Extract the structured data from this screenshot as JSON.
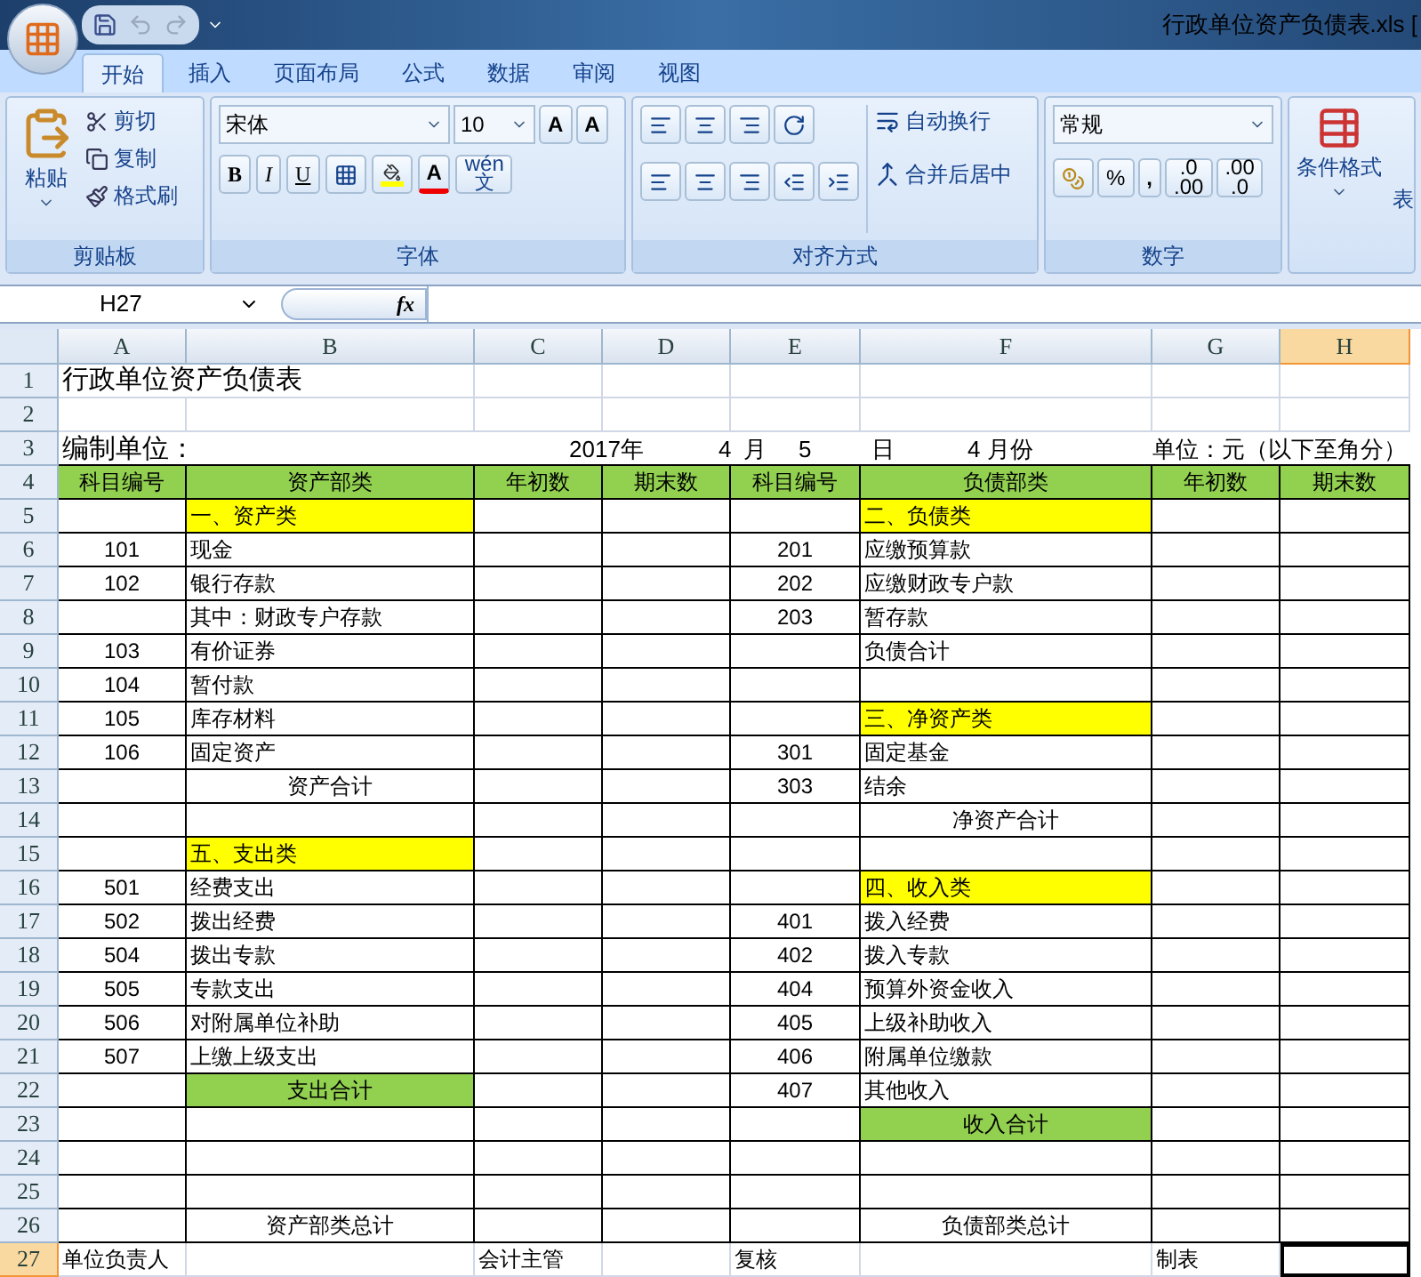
{
  "window": {
    "title": "行政单位资产负债表.xls ["
  },
  "tabs": [
    {
      "label": "开始",
      "selected": true
    },
    {
      "label": "插入",
      "selected": false
    },
    {
      "label": "页面布局",
      "selected": false
    },
    {
      "label": "公式",
      "selected": false
    },
    {
      "label": "数据",
      "selected": false
    },
    {
      "label": "审阅",
      "selected": false
    },
    {
      "label": "视图",
      "selected": false
    }
  ],
  "ribbon": {
    "clipboard": {
      "label": "剪贴板",
      "paste": "粘贴",
      "items": [
        "剪切",
        "复制",
        "格式刷"
      ]
    },
    "font": {
      "label": "字体",
      "font": "宋体",
      "size": "10",
      "grow": "A",
      "shrink": "A",
      "styles": [
        "B",
        "I",
        "U"
      ],
      "font_color": "A",
      "phonetic": [
        "wén",
        "文"
      ]
    },
    "alignment": {
      "label": "对齐方式",
      "wrap": "自动换行",
      "merge": "合并后居中"
    },
    "number": {
      "label": "数字",
      "format": "常规",
      "percent": "%",
      "comma": ",",
      "increase_decimal": [
        ".0",
        ".00"
      ],
      "decrease_decimal": [
        ".00",
        ".0"
      ]
    },
    "styles": {
      "conditional": "条件格式",
      "table": "表"
    }
  },
  "formula_bar": {
    "name_box": "H27",
    "fx": "fx"
  },
  "columns": [
    {
      "label": "A",
      "selected": false
    },
    {
      "label": "B",
      "selected": false
    },
    {
      "label": "C",
      "selected": false
    },
    {
      "label": "D",
      "selected": false
    },
    {
      "label": "E",
      "selected": false
    },
    {
      "label": "F",
      "selected": false
    },
    {
      "label": "G",
      "selected": false
    },
    {
      "label": "H",
      "selected": true
    }
  ],
  "row_numbers": [
    {
      "label": "1",
      "selected": false
    },
    {
      "label": "2",
      "selected": false
    },
    {
      "label": "3",
      "selected": false
    },
    {
      "label": "4",
      "selected": false
    },
    {
      "label": "5",
      "selected": false
    },
    {
      "label": "6",
      "selected": false
    },
    {
      "label": "7",
      "selected": false
    },
    {
      "label": "8",
      "selected": false
    },
    {
      "label": "9",
      "selected": false
    },
    {
      "label": "10",
      "selected": false
    },
    {
      "label": "11",
      "selected": false
    },
    {
      "label": "12",
      "selected": false
    },
    {
      "label": "13",
      "selected": false
    },
    {
      "label": "14",
      "selected": false
    },
    {
      "label": "15",
      "selected": false
    },
    {
      "label": "16",
      "selected": false
    },
    {
      "label": "17",
      "selected": false
    },
    {
      "label": "18",
      "selected": false
    },
    {
      "label": "19",
      "selected": false
    },
    {
      "label": "20",
      "selected": false
    },
    {
      "label": "21",
      "selected": false
    },
    {
      "label": "22",
      "selected": false
    },
    {
      "label": "23",
      "selected": false
    },
    {
      "label": "24",
      "selected": false
    },
    {
      "label": "25",
      "selected": false
    },
    {
      "label": "26",
      "selected": false
    },
    {
      "label": "27",
      "selected": true
    }
  ],
  "sheet": {
    "title": "行政单位资产负债表",
    "header_line": [
      "编制单位：",
      "2017年",
      "4",
      "月",
      "5",
      "日",
      "4 月份",
      "单位：元（以下至角分）"
    ],
    "table_headers": [
      {
        "text": "科目编号",
        "color": "#92d050"
      },
      {
        "text": "资产部类",
        "color": "#92d050"
      },
      {
        "text": "年初数",
        "color": "#92d050"
      },
      {
        "text": "期末数",
        "color": "#92d050"
      },
      {
        "text": "科目编号",
        "color": "#92d050"
      },
      {
        "text": "负债部类",
        "color": "#92d050"
      },
      {
        "text": "年初数",
        "color": "#92d050"
      },
      {
        "text": "期末数",
        "color": "#92d050"
      }
    ],
    "rows": [
      {
        "left": {
          "item": {
            "text": "一、资产类",
            "kind": "category",
            "color": "#ffff00"
          }
        },
        "right": {
          "item": {
            "text": "二、负债类",
            "kind": "category",
            "color": "#ffff00"
          }
        }
      },
      {
        "left": {
          "code": "101",
          "item": {
            "text": "现金",
            "kind": "entry"
          }
        },
        "right": {
          "code": "201",
          "item": {
            "text": "应缴预算款",
            "kind": "entry"
          }
        }
      },
      {
        "left": {
          "code": "102",
          "item": {
            "text": "银行存款",
            "kind": "entry"
          }
        },
        "right": {
          "code": "202",
          "item": {
            "text": "应缴财政专户款",
            "kind": "entry"
          }
        }
      },
      {
        "left": {
          "item": {
            "text": "其中：财政专户存款",
            "kind": "entry"
          }
        },
        "right": {
          "code": "203",
          "item": {
            "text": "暂存款",
            "kind": "entry"
          }
        }
      },
      {
        "left": {
          "code": "103",
          "item": {
            "text": "有价证券",
            "kind": "entry"
          }
        },
        "right": {
          "item": {
            "text": "负债合计",
            "kind": "entry"
          }
        }
      },
      {
        "left": {
          "code": "104",
          "item": {
            "text": "暂付款",
            "kind": "entry"
          }
        },
        "right": {}
      },
      {
        "left": {
          "code": "105",
          "item": {
            "text": "库存材料",
            "kind": "entry"
          }
        },
        "right": {
          "item": {
            "text": "三、净资产类",
            "kind": "category",
            "color": "#ffff00"
          }
        }
      },
      {
        "left": {
          "code": "106",
          "item": {
            "text": "固定资产",
            "kind": "entry"
          }
        },
        "right": {
          "code": "301",
          "item": {
            "text": "固定基金",
            "kind": "entry"
          }
        }
      },
      {
        "left": {
          "item": {
            "text": "资产合计",
            "kind": "total"
          }
        },
        "right": {
          "code": "303",
          "item": {
            "text": "结余",
            "kind": "entry"
          }
        }
      },
      {
        "left": {},
        "right": {
          "item": {
            "text": "净资产合计",
            "kind": "total"
          }
        }
      },
      {
        "left": {
          "item": {
            "text": "五、支出类",
            "kind": "category",
            "color": "#ffff00"
          }
        },
        "right": {}
      },
      {
        "left": {
          "code": "501",
          "item": {
            "text": "经费支出",
            "kind": "entry"
          }
        },
        "right": {
          "item": {
            "text": "四、收入类",
            "kind": "category",
            "color": "#ffff00"
          }
        }
      },
      {
        "left": {
          "code": "502",
          "item": {
            "text": "拨出经费",
            "kind": "entry"
          }
        },
        "right": {
          "code": "401",
          "item": {
            "text": "拨入经费",
            "kind": "entry"
          }
        }
      },
      {
        "left": {
          "code": "504",
          "item": {
            "text": "拨出专款",
            "kind": "entry"
          }
        },
        "right": {
          "code": "402",
          "item": {
            "text": "拨入专款",
            "kind": "entry"
          }
        }
      },
      {
        "left": {
          "code": "505",
          "item": {
            "text": "专款支出",
            "kind": "entry"
          }
        },
        "right": {
          "code": "404",
          "item": {
            "text": "预算外资金收入",
            "kind": "entry"
          }
        }
      },
      {
        "left": {
          "code": "506",
          "item": {
            "text": "对附属单位补助",
            "kind": "entry"
          }
        },
        "right": {
          "code": "405",
          "item": {
            "text": "上级补助收入",
            "kind": "entry"
          }
        }
      },
      {
        "left": {
          "code": "507",
          "item": {
            "text": "上缴上级支出",
            "kind": "entry"
          }
        },
        "right": {
          "code": "406",
          "item": {
            "text": "附属单位缴款",
            "kind": "entry"
          }
        }
      },
      {
        "left": {
          "item": {
            "text": "支出合计",
            "kind": "total",
            "color": "#92d050"
          }
        },
        "right": {
          "code": "407",
          "item": {
            "text": "其他收入",
            "kind": "entry"
          }
        }
      },
      {
        "left": {},
        "right": {
          "item": {
            "text": "收入合计",
            "kind": "total",
            "color": "#92d050"
          }
        }
      },
      {
        "left": {},
        "right": {}
      },
      {
        "left": {},
        "right": {}
      },
      {
        "left": {
          "item": {
            "text": "资产部类总计",
            "kind": "total"
          }
        },
        "right": {
          "item": {
            "text": "负债部类总计",
            "kind": "total"
          }
        }
      }
    ],
    "signatures": [
      "单位负责人",
      "会计主管",
      "复核",
      "制表"
    ]
  }
}
